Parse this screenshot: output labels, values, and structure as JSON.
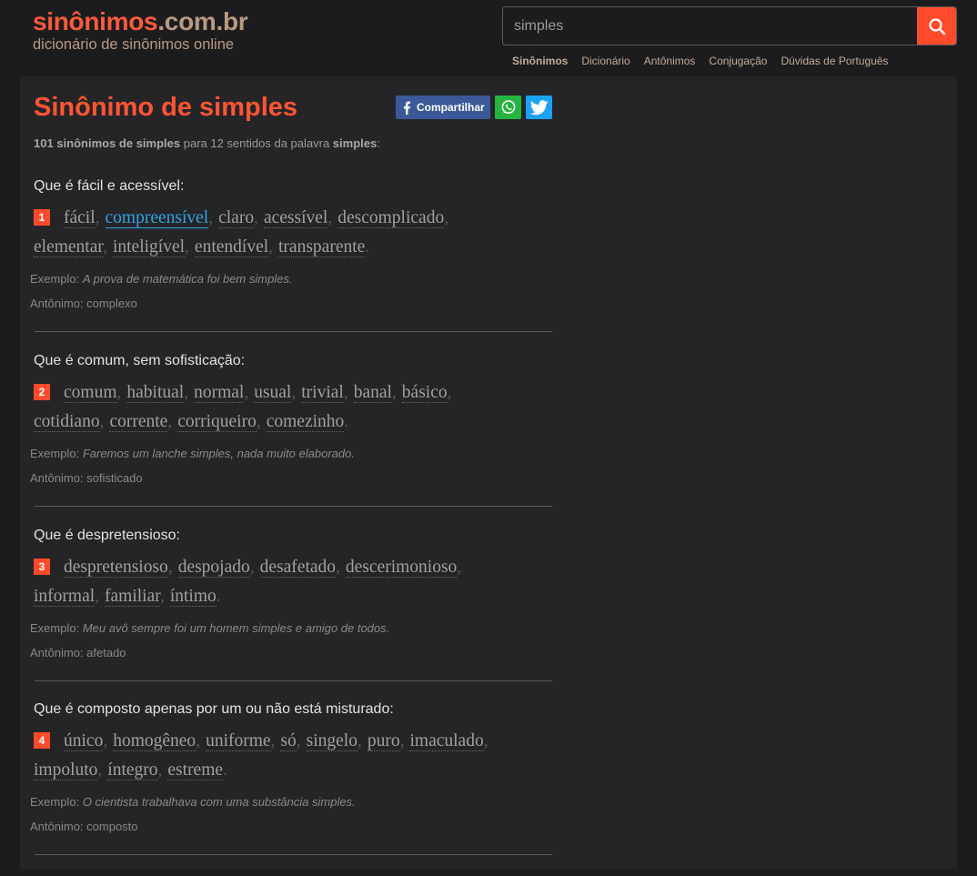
{
  "header": {
    "logo_part1": "sinônimos",
    "logo_part2": ".com.br",
    "tagline": "dicionário de sinônimos online"
  },
  "search": {
    "value": "simples",
    "icon": "search-icon"
  },
  "nav": [
    "Sinônimos",
    "Dicionário",
    "Antônimos",
    "Conjugação",
    "Dúvidas de Português"
  ],
  "page": {
    "title": "Sinônimo de simples",
    "share_label": "Compartilhar",
    "summary_bold": "101 sinônimos de simples",
    "summary_mid": " para 12 sentidos da palavra ",
    "summary_word": "simples",
    "summary_end": ":"
  },
  "colors": {
    "accent": "#ff4b2b",
    "facebook": "#3b5998",
    "whatsapp": "#25b43e",
    "twitter": "#1da1f2",
    "link_highlight": "#2ea3e3"
  },
  "example_label": "Exemplo: ",
  "antonym_label": "Antônimo: ",
  "senses": [
    {
      "number": "1",
      "title": "Que é fácil e acessível:",
      "line1": [
        "fácil",
        "compreensível",
        "claro",
        "acessível",
        "descomplicado"
      ],
      "line2": [
        "elementar",
        "inteligível",
        "entendível",
        "transparente"
      ],
      "example": "A prova de matemática foi bem simples.",
      "antonym": "complexo"
    },
    {
      "number": "2",
      "title": "Que é comum, sem sofisticação:",
      "line1": [
        "comum",
        "habitual",
        "normal",
        "usual",
        "trivial",
        "banal",
        "básico"
      ],
      "line2": [
        "cotidiano",
        "corrente",
        "corriqueiro",
        "comezinho"
      ],
      "example": "Faremos um lanche simples, nada muito elaborado.",
      "antonym": "sofisticado"
    },
    {
      "number": "3",
      "title": "Que é despretensioso:",
      "line1": [
        "despretensioso",
        "despojado",
        "desafetado",
        "descerimonioso"
      ],
      "line2": [
        "informal",
        "familiar",
        "íntimo"
      ],
      "example": "Meu avô sempre foi um homem simples e amigo de todos.",
      "antonym": "afetado"
    },
    {
      "number": "4",
      "title": "Que é composto apenas por um ou não está misturado:",
      "line1": [
        "único",
        "homogêneo",
        "uniforme",
        "só",
        "singelo",
        "puro",
        "imaculado"
      ],
      "line2": [
        "impoluto",
        "íntegro",
        "estreme"
      ],
      "example": "O cientista trabalhava com uma substância simples.",
      "antonym": "composto"
    }
  ]
}
